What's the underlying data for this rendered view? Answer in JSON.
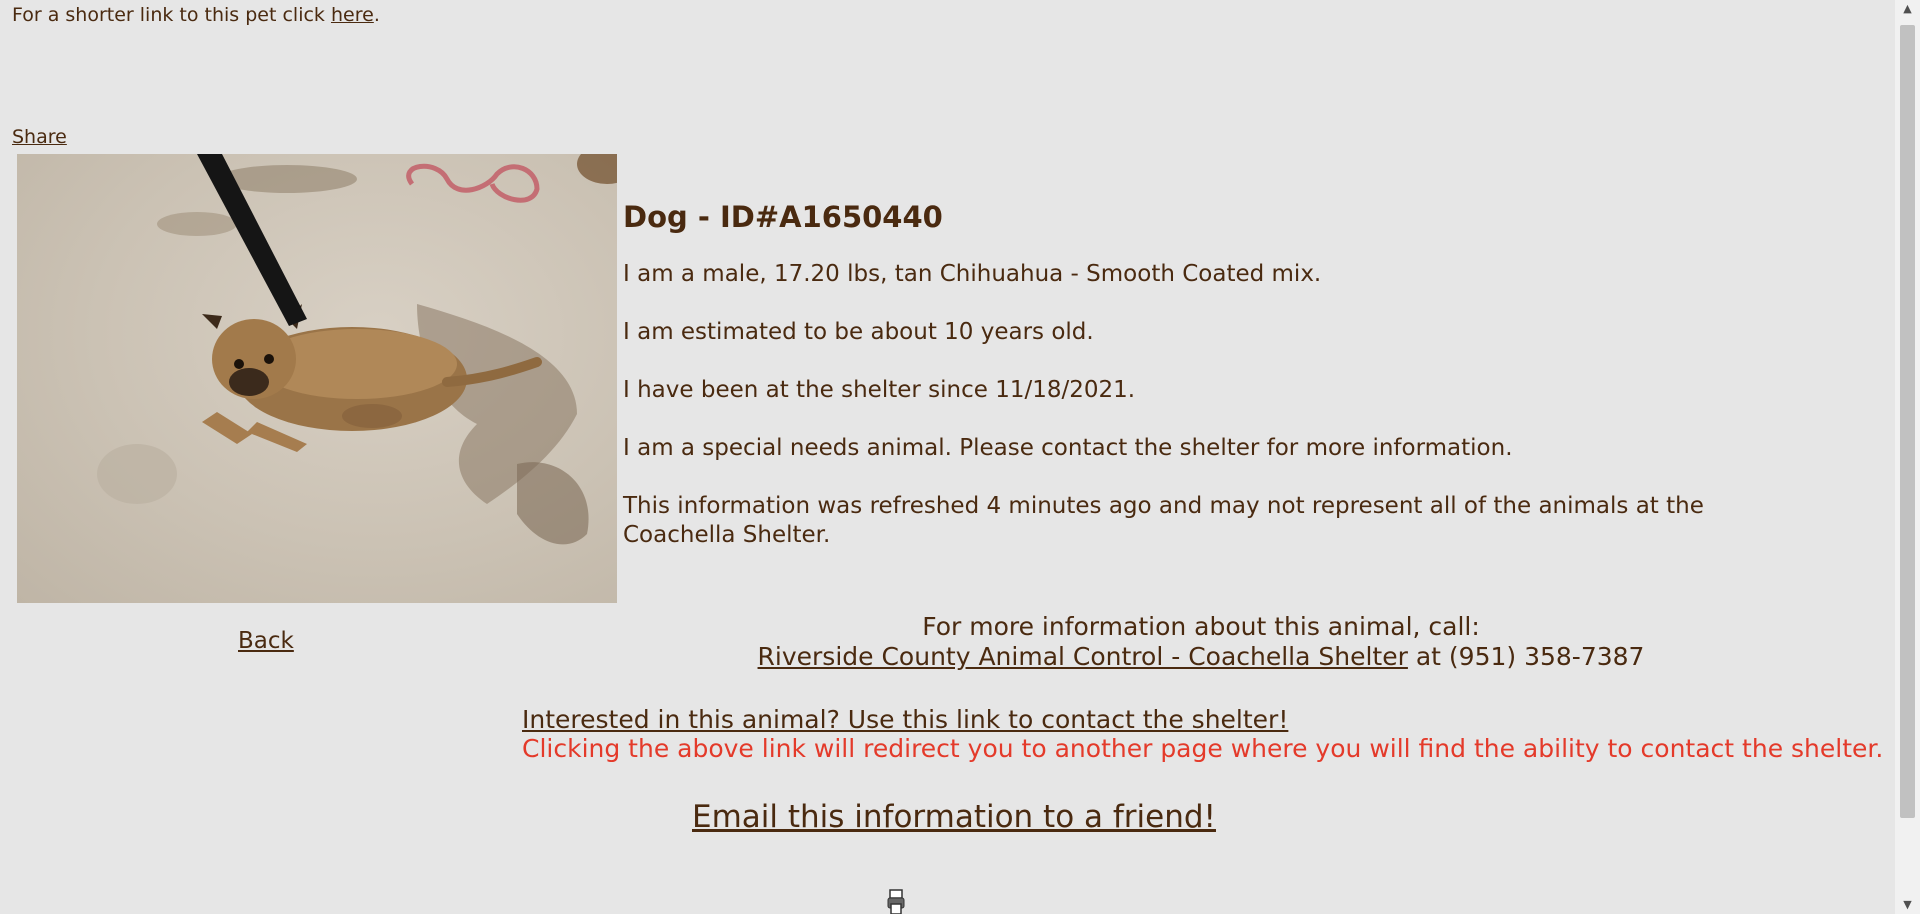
{
  "header": {
    "short_link_prefix": "For a shorter link to this pet click ",
    "short_link_label": "here",
    "short_link_suffix": ".",
    "share_label": "Share"
  },
  "pet": {
    "title": "Dog - ID#A1650440",
    "description": "I am a male, 17.20 lbs, tan Chihuahua - Smooth Coated mix.",
    "age": "I am estimated to be about 10 years old.",
    "since": "I have been at the shelter since 11/18/2021.",
    "special_needs": "I am a special needs animal. Please contact the shelter for more information.",
    "refresh_note": "This information was refreshed 4 minutes ago and may not represent all of the animals at the Coachella Shelter."
  },
  "nav": {
    "back_label": "Back"
  },
  "contact": {
    "call_text": "For more information about this animal, call:",
    "shelter_link": "Riverside County Animal Control - Coachella Shelter",
    "phone_text": " at (951) 358-7387",
    "interested_link": "Interested in this animal? Use this link to contact the shelter!",
    "redirect_note": "Clicking the above link will redirect you to another page where you will find the ability to contact the shelter.",
    "email_link": "Email this information to a friend!"
  },
  "colors": {
    "background": "#e6e6e6",
    "text": "#4a2a10",
    "warning": "#e43a2a"
  },
  "icons": {
    "bottom": "printer-icon"
  }
}
